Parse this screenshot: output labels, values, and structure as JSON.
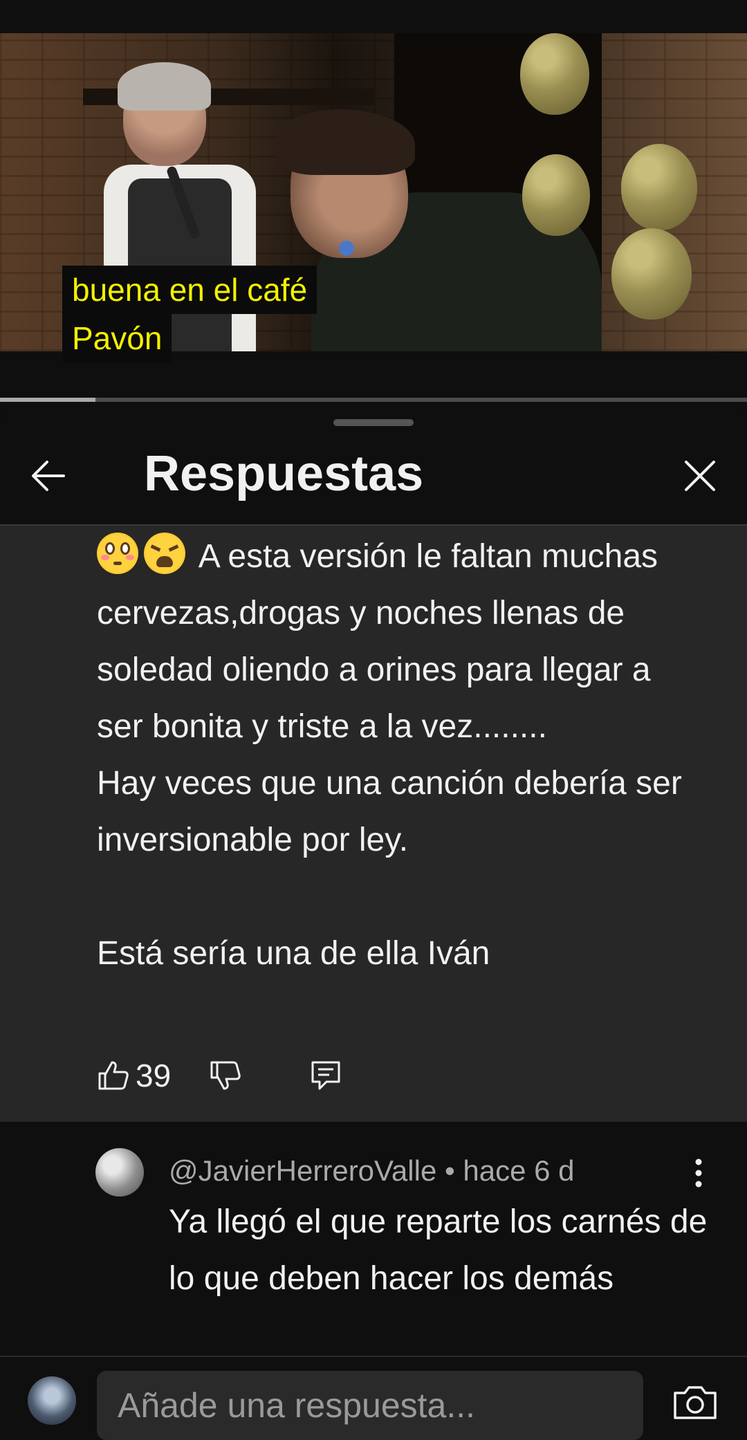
{
  "video": {
    "subtitle_lines": [
      "buena en el café",
      "Pavón"
    ],
    "progress_fraction": 0.128
  },
  "sheet": {
    "title": "Respuestas"
  },
  "parent_comment": {
    "text": "😳😩 A esta versión le faltan muchas cervezas,drogas y noches llenas de soledad oliendo a orines para llegar a ser bonita y triste a la vez........\nHay veces que una canción debería ser inversionable por ley.\n\nEstá sería una de ella Iván",
    "text_body": "A esta versión le faltan muchas cervezas,drogas y noches llenas de soledad oliendo a orines para llegar a ser bonita y triste a la vez........\nHay veces que una canción debería ser inversionable por ley.\n\nEstá sería una de ella Iván",
    "like_count": "39"
  },
  "reply": {
    "author": "@JavierHerreroValle",
    "separator": "•",
    "time": "hace 6 d",
    "text": "Ya llegó el que reparte los carnés de lo que deben hacer los demás"
  },
  "composer": {
    "placeholder": "Añade una respuesta..."
  },
  "icons": {
    "back": "arrow-left-icon",
    "close": "close-icon",
    "like": "thumb-up-icon",
    "dislike": "thumb-down-icon",
    "reply": "comment-icon",
    "more": "more-vertical-icon",
    "camera": "camera-icon"
  },
  "colors": {
    "subtitle_text": "#f3f100",
    "highlight_bg": "#272727",
    "background": "#0f0f0f"
  }
}
